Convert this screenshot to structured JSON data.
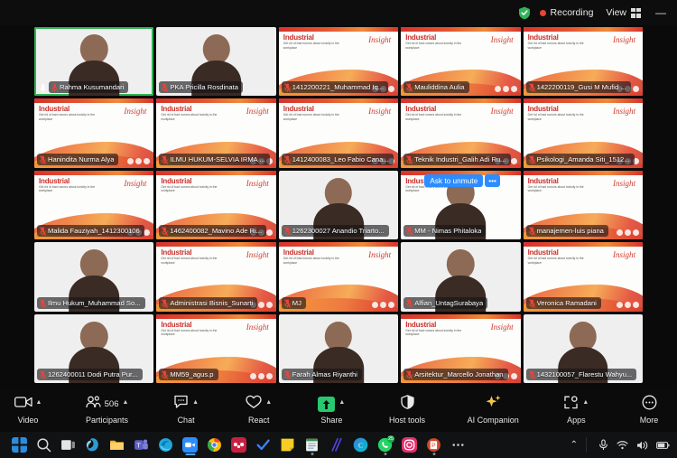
{
  "topbar": {
    "encryption_icon": "shield-check-icon",
    "recording_label": "Recording",
    "view_label": "View",
    "view_icon": "grid-icon",
    "minimize_label": "—"
  },
  "meeting": {
    "slide": {
      "title": "Industrial",
      "subtitle": "Get rid of bad rumors about toxicity in the workplace",
      "script": "Insight"
    },
    "unmute": {
      "button_label": "Ask to unmute",
      "more_label": "•••"
    },
    "tiles": [
      {
        "name": "Rahma Kusumandari",
        "kind": "cam-person",
        "active": true,
        "muted": false,
        "pinned": true
      },
      {
        "name": "PKA Pricilla Rosdinata",
        "kind": "cam-person",
        "active": false,
        "muted": true
      },
      {
        "name": "1412200221_Muhammad Iq...",
        "kind": "slide",
        "active": false,
        "muted": true
      },
      {
        "name": "Mauliddina Aulia",
        "kind": "slide",
        "active": false,
        "muted": true
      },
      {
        "name": "1422200119_Gusi M Mufid ...",
        "kind": "slide",
        "active": false,
        "muted": true
      },
      {
        "name": "Hanindita Nurma Alya",
        "kind": "slide",
        "active": false,
        "muted": true
      },
      {
        "name": "ILMU HUKUM-SELVIA IRMA ...",
        "kind": "slide",
        "active": false,
        "muted": true
      },
      {
        "name": "1412400083_Leo Fabio Cana...",
        "kind": "slide",
        "active": false,
        "muted": true
      },
      {
        "name": "Teknik Industri_Galih Adi Ru...",
        "kind": "slide",
        "active": false,
        "muted": true
      },
      {
        "name": "Psikologi_Amanda Siti_1512...",
        "kind": "slide",
        "active": false,
        "muted": true
      },
      {
        "name": "Malida Fauziyah_1412300106",
        "kind": "slide",
        "active": false,
        "muted": true
      },
      {
        "name": "1462400082_Mavino Ade Ri...",
        "kind": "slide",
        "active": false,
        "muted": true
      },
      {
        "name": "1262300027 Anandio Triarto...",
        "kind": "cam-person",
        "active": false,
        "muted": true
      },
      {
        "name": "MM - Nimas Phitaloka",
        "kind": "cam-person",
        "active": false,
        "muted": true,
        "unmute_prompt": true
      },
      {
        "name": "manajemen-luis piana",
        "kind": "slide",
        "active": false,
        "muted": true
      },
      {
        "name": "Ilmu Hukum_Muhammad So...",
        "kind": "cam-person",
        "active": false,
        "muted": true
      },
      {
        "name": "Administrasi Bisnis_Sunarti",
        "kind": "slide",
        "active": false,
        "muted": true
      },
      {
        "name": "MJ",
        "kind": "slide",
        "active": false,
        "muted": true
      },
      {
        "name": "Alfian_UntagSurabaya",
        "kind": "cam-person",
        "active": false,
        "muted": true
      },
      {
        "name": "Veronica Ramadani",
        "kind": "slide",
        "active": false,
        "muted": true
      },
      {
        "name": "1262400011 Dodi Putra Pur...",
        "kind": "cam-person",
        "active": false,
        "muted": true
      },
      {
        "name": "MM59_agus.p",
        "kind": "slide",
        "active": false,
        "muted": true
      },
      {
        "name": "Farah Almas Riyanthi",
        "kind": "cam-person",
        "active": false,
        "muted": true
      },
      {
        "name": "Arsitektur_Marcello Jonathan",
        "kind": "slide",
        "active": false,
        "muted": true
      },
      {
        "name": "1432100057_Flarestu Wahyu...",
        "kind": "cam-person",
        "active": false,
        "muted": true
      }
    ]
  },
  "controlbar": {
    "items": [
      {
        "label": "Video",
        "icon": "video-camera-icon",
        "caret": true,
        "count": ""
      },
      {
        "label": "Participants",
        "icon": "people-icon",
        "caret": true,
        "count": "506"
      },
      {
        "label": "Chat",
        "icon": "chat-bubble-icon",
        "caret": true,
        "count": ""
      },
      {
        "label": "React",
        "icon": "heart-icon",
        "caret": true,
        "count": ""
      },
      {
        "label": "Share",
        "icon": "share-arrow-icon",
        "caret": true,
        "count": ""
      },
      {
        "label": "Host tools",
        "icon": "shield-icon",
        "caret": false,
        "count": ""
      },
      {
        "label": "AI Companion",
        "icon": "sparkle-icon",
        "caret": false,
        "count": ""
      },
      {
        "label": "Apps",
        "icon": "apps-icon",
        "caret": true,
        "count": ""
      },
      {
        "label": "More",
        "icon": "ellipsis-circle-icon",
        "caret": false,
        "count": ""
      }
    ],
    "accent_color": "#29c76f",
    "ai_color": "#f2c744"
  },
  "taskbar": {
    "apps": [
      {
        "name": "start-button",
        "color": "#2d8cdb"
      },
      {
        "name": "search-icon",
        "color": "#d8d8d8"
      },
      {
        "name": "task-view-icon",
        "color": "#b9b9b9"
      },
      {
        "name": "copilot-icon",
        "color": "#2e9ad0"
      },
      {
        "name": "file-explorer-icon",
        "color": "#f0b429"
      },
      {
        "name": "microsoft-teams-icon",
        "color": "#5b5fc7"
      },
      {
        "name": "microsoft-edge-icon",
        "color": "#1fa8dd"
      },
      {
        "name": "zoom-icon",
        "color": "#2d8cff",
        "running": true
      },
      {
        "name": "google-chrome-icon",
        "color": "#34a853"
      },
      {
        "name": "mendeley-icon",
        "color": "#c9203f"
      },
      {
        "name": "todo-check-icon",
        "color": "#3b82f6"
      },
      {
        "name": "sticky-notes-icon",
        "color": "#f5cd23"
      },
      {
        "name": "notepad-icon",
        "color": "#3f8f4f",
        "running": true
      },
      {
        "name": "grammarly-icon",
        "color": "#4f46e5"
      },
      {
        "name": "canva-icon",
        "color": "#00c4cc"
      },
      {
        "name": "whatsapp-icon",
        "color": "#25d366",
        "badge": "25",
        "running": true
      },
      {
        "name": "instagram-icon",
        "color": "#e1306c"
      },
      {
        "name": "powerpoint-icon",
        "color": "#d24726",
        "running": true
      },
      {
        "name": "overflow-icon",
        "color": "#cfcfcf"
      }
    ],
    "tray": [
      {
        "name": "show-hidden-icons-chevron",
        "glyph": "⌃"
      },
      {
        "name": "microphone-icon",
        "glyph": "mic"
      },
      {
        "name": "wifi-icon",
        "glyph": "wifi"
      },
      {
        "name": "volume-icon",
        "glyph": "vol"
      },
      {
        "name": "battery-icon",
        "glyph": "bat"
      }
    ]
  }
}
